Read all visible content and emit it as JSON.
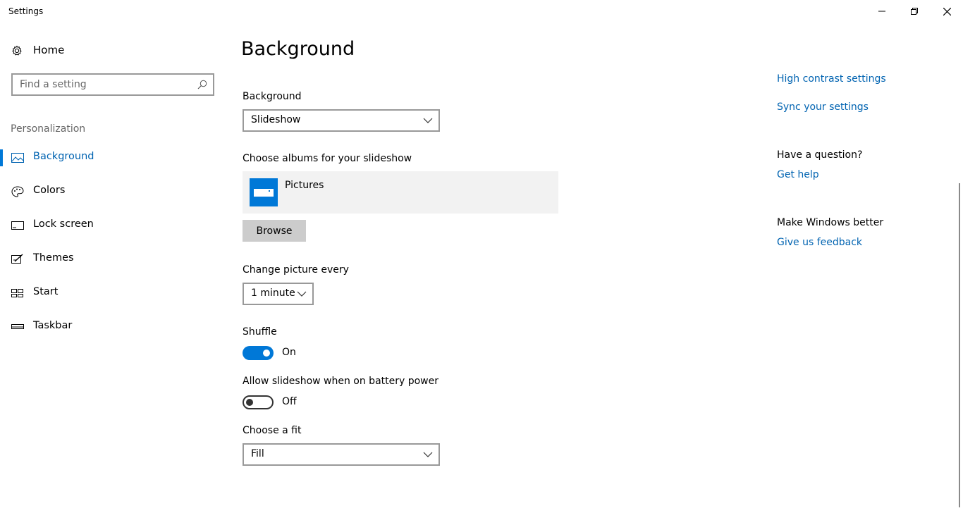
{
  "window": {
    "title": "Settings",
    "controls": {
      "minimize": "minimize-icon",
      "maximize": "restore-icon",
      "close": "close-icon"
    }
  },
  "sidebar": {
    "home_label": "Home",
    "search_placeholder": "Find a setting",
    "section_title": "Personalization",
    "items": [
      {
        "label": "Background",
        "icon": "picture-icon",
        "active": true
      },
      {
        "label": "Colors",
        "icon": "palette-icon",
        "active": false
      },
      {
        "label": "Lock screen",
        "icon": "lock-screen-icon",
        "active": false
      },
      {
        "label": "Themes",
        "icon": "brush-icon",
        "active": false
      },
      {
        "label": "Start",
        "icon": "start-tiles-icon",
        "active": false
      },
      {
        "label": "Taskbar",
        "icon": "taskbar-icon",
        "active": false
      }
    ]
  },
  "main": {
    "title": "Background",
    "background_label": "Background",
    "background_value": "Slideshow",
    "albums_label": "Choose albums for your slideshow",
    "album_name": "Pictures",
    "browse_label": "Browse",
    "change_label": "Change picture every",
    "change_value": "1 minute",
    "shuffle_label": "Shuffle",
    "shuffle_state": "On",
    "battery_label": "Allow slideshow when on battery power",
    "battery_state": "Off",
    "fit_label": "Choose a fit",
    "fit_value": "Fill"
  },
  "rail": {
    "high_contrast": "High contrast settings",
    "sync": "Sync your settings",
    "question_heading": "Have a question?",
    "get_help": "Get help",
    "better_heading": "Make Windows better",
    "feedback": "Give us feedback"
  },
  "colors": {
    "accent": "#0078d7",
    "link": "#0063b1"
  }
}
